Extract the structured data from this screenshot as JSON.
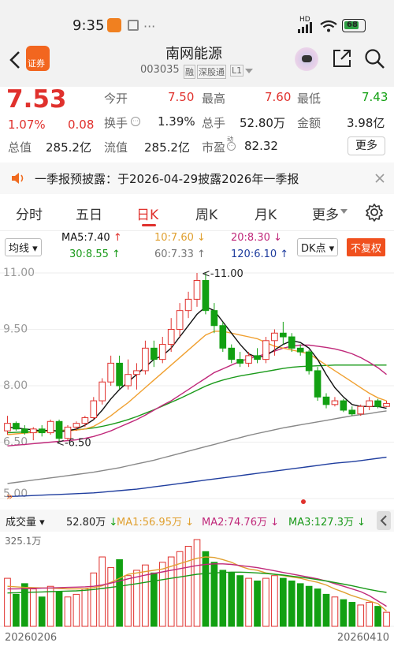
{
  "status": {
    "time": "9:35",
    "battery": "68",
    "signal": "HD"
  },
  "header": {
    "broker_badge": "证券",
    "stock_name": "南网能源",
    "stock_code": "003035",
    "tag_rong": "融",
    "tag_sgt": "深股通",
    "tag_level": "L1"
  },
  "quote": {
    "price": "7.53",
    "change_pct": "1.07%",
    "change_amt": "0.08",
    "open_label": "今开",
    "open": "7.50",
    "high_label": "最高",
    "high": "7.60",
    "low_label": "最低",
    "low": "7.43",
    "turnover_label": "换手",
    "turnover": "1.39%",
    "volume_label": "总手",
    "volume": "52.80万",
    "amount_label": "金额",
    "amount": "3.98亿",
    "mktcap_label": "总值",
    "mktcap": "285.2亿",
    "float_label": "流值",
    "float": "285.2亿",
    "pe_label": "市盈",
    "pe_sup": "动",
    "pe": "82.32",
    "more_label": "更多"
  },
  "notice": {
    "text": "一季报预披露：于2026-04-29披露2026年一季报"
  },
  "tabs": [
    {
      "label": "分时"
    },
    {
      "label": "五日"
    },
    {
      "label": "日K"
    },
    {
      "label": "周K"
    },
    {
      "label": "月K"
    },
    {
      "label": "更多"
    }
  ],
  "ma_legend": {
    "type_select": "均线",
    "ma5": "MA5:7.40",
    "ma10": "10:7.60",
    "ma20": "20:8.30",
    "ma30": "30:8.55",
    "ma60": "60:7.33",
    "ma120": "120:6.10",
    "dk": "DK点",
    "fq": "不复权"
  },
  "vol_legend": {
    "select": "成交量",
    "vol": "52.80万",
    "ma1": "MA1:56.95万",
    "ma2": "MA2:74.76万",
    "ma3": "MA3:127.3万"
  },
  "annotations": {
    "max_label": "<-11.00",
    "min_label": "<-6.50"
  },
  "chart_data": [
    {
      "type": "candlestick",
      "y_ticks": [
        "11.00",
        "9.50",
        "8.00",
        "6.50",
        "5.00"
      ],
      "ylim": [
        5.0,
        11.0
      ],
      "colors": {
        "up": "#e0312d",
        "down": "#12a012",
        "ma5": "#111111",
        "ma10": "#f0a030",
        "ma20": "#c0287a",
        "ma30": "#1a9a1a",
        "ma60": "#888888",
        "ma120": "#1f3d9e"
      },
      "candles": [
        [
          6.8,
          7.2,
          6.7,
          7.0
        ],
        [
          7.0,
          7.05,
          6.8,
          6.85
        ],
        [
          6.85,
          6.95,
          6.7,
          6.75
        ],
        [
          6.75,
          6.9,
          6.55,
          6.85
        ],
        [
          6.85,
          6.95,
          6.65,
          6.75
        ],
        [
          6.75,
          7.1,
          6.7,
          7.05
        ],
        [
          7.05,
          7.1,
          6.5,
          6.6
        ],
        [
          6.6,
          6.95,
          6.55,
          6.9
        ],
        [
          6.9,
          7.05,
          6.8,
          7.0
        ],
        [
          7.0,
          7.2,
          6.9,
          7.15
        ],
        [
          7.15,
          7.7,
          7.1,
          7.6
        ],
        [
          7.6,
          8.2,
          7.5,
          8.1
        ],
        [
          8.1,
          8.8,
          8.0,
          8.6
        ],
        [
          8.6,
          8.8,
          7.9,
          8.0
        ],
        [
          8.0,
          8.7,
          7.9,
          8.3
        ],
        [
          8.3,
          8.6,
          7.9,
          8.4
        ],
        [
          8.4,
          9.2,
          8.3,
          9.0
        ],
        [
          9.0,
          9.2,
          8.5,
          8.7
        ],
        [
          8.7,
          9.3,
          8.6,
          9.1
        ],
        [
          9.1,
          9.8,
          8.9,
          9.5
        ],
        [
          9.5,
          10.2,
          9.3,
          10.0
        ],
        [
          10.0,
          10.5,
          9.8,
          10.3
        ],
        [
          10.3,
          11.0,
          10.1,
          10.8
        ],
        [
          10.8,
          11.0,
          9.9,
          10.0
        ],
        [
          10.0,
          10.2,
          9.4,
          9.6
        ],
        [
          9.6,
          9.7,
          8.9,
          9.0
        ],
        [
          9.0,
          9.1,
          8.6,
          8.7
        ],
        [
          8.7,
          8.9,
          8.5,
          8.6
        ],
        [
          8.6,
          8.9,
          8.5,
          8.8
        ],
        [
          8.8,
          9.0,
          8.6,
          8.7
        ],
        [
          8.7,
          9.3,
          8.6,
          9.2
        ],
        [
          9.2,
          9.5,
          8.8,
          9.4
        ],
        [
          9.4,
          9.7,
          9.1,
          9.3
        ],
        [
          9.3,
          9.4,
          8.9,
          9.0
        ],
        [
          9.0,
          9.1,
          8.8,
          8.9
        ],
        [
          8.9,
          8.95,
          8.3,
          8.4
        ],
        [
          8.4,
          8.5,
          7.6,
          7.7
        ],
        [
          7.7,
          7.8,
          7.4,
          7.5
        ],
        [
          7.5,
          7.7,
          7.45,
          7.6
        ],
        [
          7.6,
          7.65,
          7.3,
          7.35
        ],
        [
          7.35,
          7.45,
          7.2,
          7.25
        ],
        [
          7.25,
          7.5,
          7.2,
          7.45
        ],
        [
          7.45,
          7.7,
          7.35,
          7.6
        ],
        [
          7.6,
          7.65,
          7.4,
          7.45
        ],
        [
          7.45,
          7.6,
          7.43,
          7.53
        ]
      ],
      "ma5": [
        6.9,
        6.88,
        6.85,
        6.83,
        6.8,
        6.82,
        6.78,
        6.8,
        6.85,
        6.95,
        7.1,
        7.35,
        7.65,
        7.9,
        8.1,
        8.3,
        8.5,
        8.7,
        8.8,
        9.0,
        9.3,
        9.6,
        9.9,
        10.1,
        10.0,
        9.7,
        9.4,
        9.1,
        8.85,
        8.75,
        8.8,
        8.95,
        9.1,
        9.2,
        9.15,
        9.0,
        8.7,
        8.3,
        7.95,
        7.7,
        7.5,
        7.45,
        7.45,
        7.45,
        7.4
      ],
      "ma10": [
        6.7,
        6.72,
        6.74,
        6.76,
        6.78,
        6.8,
        6.8,
        6.8,
        6.82,
        6.85,
        6.92,
        7.05,
        7.2,
        7.38,
        7.55,
        7.75,
        7.95,
        8.15,
        8.35,
        8.55,
        8.75,
        8.95,
        9.15,
        9.35,
        9.45,
        9.45,
        9.4,
        9.35,
        9.3,
        9.25,
        9.15,
        9.05,
        9.0,
        8.95,
        8.9,
        8.85,
        8.7,
        8.55,
        8.4,
        8.25,
        8.1,
        7.95,
        7.8,
        7.68,
        7.6
      ],
      "ma20": [
        6.4,
        6.42,
        6.44,
        6.46,
        6.48,
        6.5,
        6.52,
        6.54,
        6.56,
        6.6,
        6.65,
        6.72,
        6.8,
        6.9,
        7.0,
        7.1,
        7.22,
        7.35,
        7.48,
        7.6,
        7.75,
        7.9,
        8.05,
        8.2,
        8.35,
        8.45,
        8.55,
        8.65,
        8.72,
        8.78,
        8.85,
        8.92,
        9.0,
        9.05,
        9.08,
        9.08,
        9.05,
        9.02,
        8.98,
        8.92,
        8.85,
        8.75,
        8.62,
        8.48,
        8.3
      ],
      "ma30": [
        6.75,
        6.76,
        6.77,
        6.78,
        6.79,
        6.8,
        6.81,
        6.82,
        6.83,
        6.85,
        6.88,
        6.92,
        6.97,
        7.03,
        7.1,
        7.18,
        7.27,
        7.36,
        7.46,
        7.56,
        7.66,
        7.77,
        7.88,
        7.99,
        8.08,
        8.15,
        8.21,
        8.26,
        8.3,
        8.34,
        8.38,
        8.42,
        8.46,
        8.49,
        8.51,
        8.52,
        8.53,
        8.54,
        8.55,
        8.55,
        8.55,
        8.55,
        8.55,
        8.55,
        8.55
      ],
      "ma60": [
        5.4,
        5.43,
        5.46,
        5.49,
        5.52,
        5.55,
        5.58,
        5.61,
        5.64,
        5.67,
        5.7,
        5.74,
        5.78,
        5.82,
        5.87,
        5.92,
        5.97,
        6.02,
        6.08,
        6.14,
        6.2,
        6.26,
        6.32,
        6.38,
        6.44,
        6.5,
        6.56,
        6.62,
        6.68,
        6.73,
        6.78,
        6.83,
        6.88,
        6.92,
        6.96,
        7.0,
        7.04,
        7.08,
        7.12,
        7.16,
        7.2,
        7.23,
        7.26,
        7.3,
        7.33
      ],
      "ma120": [
        5.05,
        5.06,
        5.07,
        5.08,
        5.09,
        5.1,
        5.11,
        5.12,
        5.13,
        5.14,
        5.15,
        5.17,
        5.19,
        5.21,
        5.23,
        5.25,
        5.28,
        5.31,
        5.34,
        5.37,
        5.4,
        5.43,
        5.46,
        5.49,
        5.52,
        5.55,
        5.58,
        5.61,
        5.64,
        5.67,
        5.7,
        5.73,
        5.76,
        5.79,
        5.82,
        5.85,
        5.88,
        5.91,
        5.94,
        5.96,
        5.98,
        6.01,
        6.04,
        6.07,
        6.1
      ]
    },
    {
      "type": "bar",
      "y_max_label": "325.1万",
      "x_start": "20260206",
      "x_end": "20260410",
      "vol_max": 325.1,
      "volumes": [
        180,
        120,
        160,
        140,
        110,
        150,
        130,
        110,
        120,
        140,
        200,
        260,
        220,
        250,
        190,
        210,
        230,
        200,
        240,
        260,
        280,
        300,
        325,
        280,
        240,
        210,
        200,
        190,
        180,
        170,
        180,
        190,
        180,
        170,
        160,
        150,
        140,
        120,
        110,
        100,
        90,
        80,
        90,
        75,
        52.8
      ],
      "ma1": [
        150,
        148,
        146,
        145,
        144,
        143,
        142,
        140,
        140,
        141,
        145,
        152,
        165,
        180,
        195,
        200,
        205,
        210,
        215,
        225,
        235,
        245,
        255,
        260,
        258,
        250,
        240,
        225,
        215,
        210,
        200,
        195,
        190,
        185,
        180,
        172,
        165,
        155,
        140,
        128,
        115,
        105,
        95,
        85,
        57
      ],
      "ma2": [
        140,
        140,
        141,
        142,
        143,
        144,
        145,
        146,
        147,
        148,
        150,
        155,
        162,
        170,
        178,
        185,
        192,
        198,
        204,
        210,
        216,
        222,
        228,
        232,
        234,
        234,
        232,
        228,
        224,
        220,
        214,
        208,
        202,
        196,
        190,
        184,
        178,
        170,
        160,
        150,
        140,
        130,
        115,
        95,
        75
      ],
      "ma3": [
        125,
        126,
        127,
        128,
        129,
        130,
        131,
        132,
        133,
        135,
        138,
        142,
        146,
        150,
        155,
        160,
        165,
        170,
        175,
        180,
        185,
        190,
        195,
        198,
        200,
        202,
        203,
        203,
        202,
        200,
        198,
        195,
        192,
        188,
        184,
        180,
        175,
        170,
        164,
        158,
        152,
        145,
        138,
        132,
        127
      ]
    }
  ]
}
